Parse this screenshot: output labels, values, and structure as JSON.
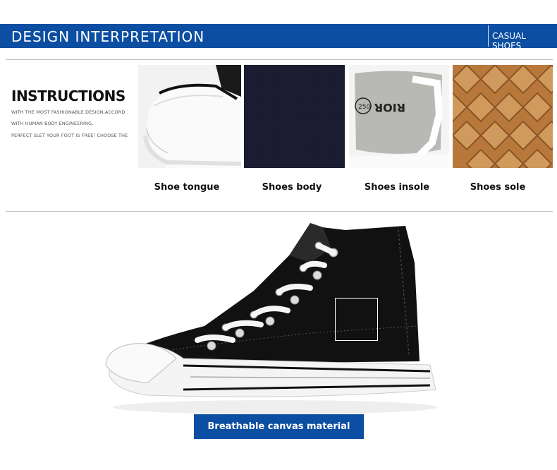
{
  "banner": {
    "title": "DESIGN  INTERPRETATION",
    "subtitle": "CASUAL SHOES"
  },
  "instructions": {
    "title": "INSTRUCTIONS",
    "lines": [
      "WITH THE MOST FASHIONABLE DESIGN,ACCORD",
      "WITH HUMAN BODY ENGINEERING,",
      "PERFECT SLET YOUR FOOT IS FREE! CHOOSE THE"
    ]
  },
  "details": [
    {
      "caption": "Shoe tongue",
      "icon": "shoe-toe-photo"
    },
    {
      "caption": "Shoes body",
      "icon": "canvas-fabric-photo"
    },
    {
      "caption": "Shoes insole",
      "icon": "insole-photo",
      "insole_text": "RIOR",
      "size_stamp": "250"
    },
    {
      "caption": "Shoes sole",
      "icon": "sole-tread-photo"
    }
  ],
  "feature": {
    "label": "Breathable canvas material"
  },
  "colors": {
    "brand_blue": "#0b4ea2",
    "canvas_black": "#111111",
    "sole_tan": "#b8783c"
  }
}
